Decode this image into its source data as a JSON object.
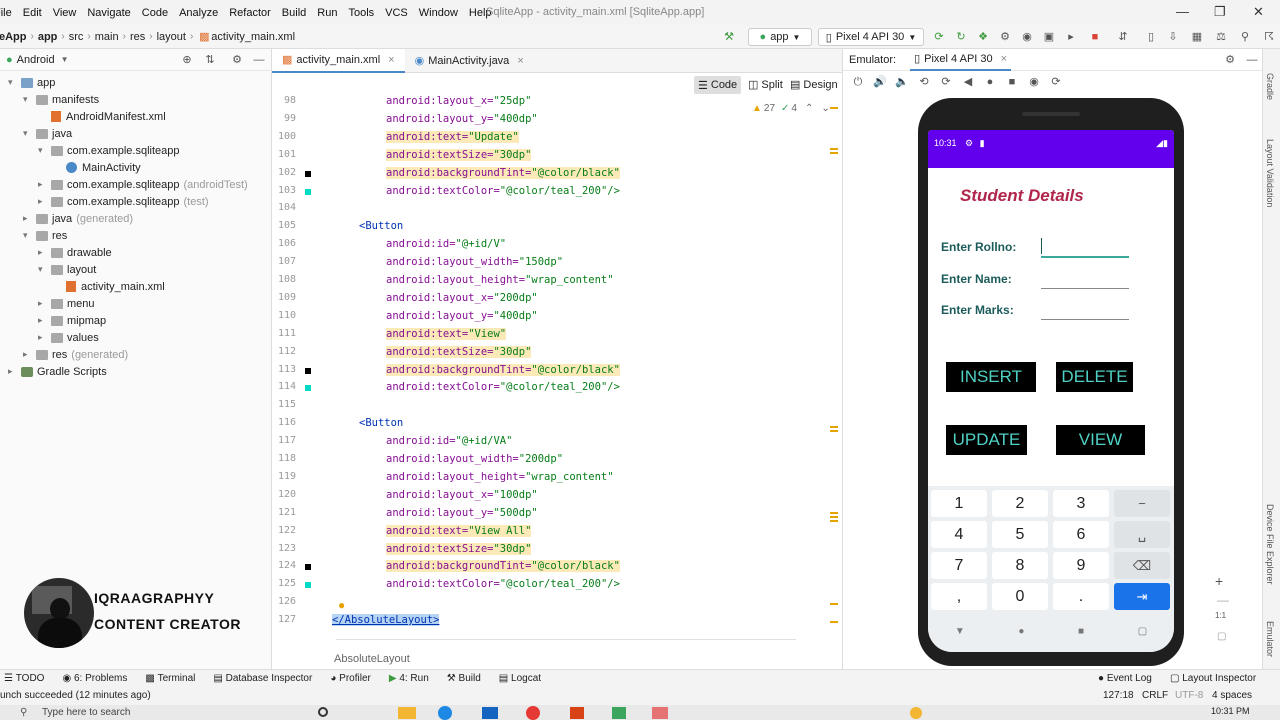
{
  "menu": {
    "items": [
      "File",
      "Edit",
      "View",
      "Navigate",
      "Code",
      "Analyze",
      "Refactor",
      "Build",
      "Run",
      "Tools",
      "VCS",
      "Window",
      "Help"
    ],
    "window_title": "SqliteApp - activity_main.xml [SqliteApp.app]"
  },
  "navbar": {
    "crumbs": [
      "eApp",
      "app",
      "src",
      "main",
      "res",
      "layout",
      "activity_main.xml"
    ],
    "run_config": "app",
    "device": "Pixel 4 API 30"
  },
  "project": {
    "view_label": "Android",
    "items": [
      {
        "label": "app",
        "depth": 0,
        "type": "folder",
        "open": true
      },
      {
        "label": "manifests",
        "depth": 1,
        "type": "folder",
        "open": true
      },
      {
        "label": "AndroidManifest.xml",
        "depth": 2,
        "type": "file"
      },
      {
        "label": "java",
        "depth": 1,
        "type": "folder",
        "open": true
      },
      {
        "label": "com.example.sqliteapp",
        "depth": 2,
        "type": "folder",
        "open": true
      },
      {
        "label": "MainActivity",
        "depth": 3,
        "type": "class"
      },
      {
        "label": "com.example.sqliteapp",
        "suffix": "(androidTest)",
        "depth": 2,
        "type": "folder"
      },
      {
        "label": "com.example.sqliteapp",
        "suffix": "(test)",
        "depth": 2,
        "type": "folder"
      },
      {
        "label": "java",
        "suffix": "(generated)",
        "depth": 1,
        "type": "folder"
      },
      {
        "label": "res",
        "depth": 1,
        "type": "folder",
        "open": true
      },
      {
        "label": "drawable",
        "depth": 2,
        "type": "folder"
      },
      {
        "label": "layout",
        "depth": 2,
        "type": "folder",
        "open": true
      },
      {
        "label": "activity_main.xml",
        "depth": 3,
        "type": "file"
      },
      {
        "label": "menu",
        "depth": 2,
        "type": "folder"
      },
      {
        "label": "mipmap",
        "depth": 2,
        "type": "folder"
      },
      {
        "label": "values",
        "depth": 2,
        "type": "folder"
      },
      {
        "label": "res",
        "suffix": "(generated)",
        "depth": 1,
        "type": "folder"
      },
      {
        "label": "Gradle Scripts",
        "depth": 0,
        "type": "gradle"
      }
    ]
  },
  "editor": {
    "tabs": [
      "activity_main.xml",
      "MainActivity.java"
    ],
    "modes": [
      "Code",
      "Split",
      "Design"
    ],
    "inspections": {
      "warnings": "27",
      "weak": "4"
    },
    "breadcrumb": "AbsoluteLayout",
    "lines": [
      {
        "n": "98",
        "indent": 2,
        "attr": "android:layout_x=",
        "val": "\"25dp\""
      },
      {
        "n": "99",
        "indent": 2,
        "attr": "android:layout_y=",
        "val": "\"400dp\""
      },
      {
        "n": "100",
        "indent": 2,
        "attr": "android:text=",
        "val": "\"Update\"",
        "hl": true
      },
      {
        "n": "101",
        "indent": 2,
        "attr": "android:textSize=",
        "val": "\"30dp\"",
        "hl": true
      },
      {
        "n": "102",
        "indent": 2,
        "attr": "android:backgroundTint=",
        "val": "\"@color/black\"",
        "hl": true,
        "mark": "#000000"
      },
      {
        "n": "103",
        "indent": 2,
        "attr": "android:textColor=",
        "val": "\"@color/teal_200\"/>",
        "mark": "#03dac5"
      },
      {
        "n": "104",
        "indent": 0,
        "attr": "",
        "val": ""
      },
      {
        "n": "105",
        "indent": 1,
        "tag": "<Button"
      },
      {
        "n": "106",
        "indent": 2,
        "attr": "android:id=",
        "val": "\"@+id/V\""
      },
      {
        "n": "107",
        "indent": 2,
        "attr": "android:layout_width=",
        "val": "\"150dp\""
      },
      {
        "n": "108",
        "indent": 2,
        "attr": "android:layout_height=",
        "val": "\"wrap_content\""
      },
      {
        "n": "109",
        "indent": 2,
        "attr": "android:layout_x=",
        "val": "\"200dp\""
      },
      {
        "n": "110",
        "indent": 2,
        "attr": "android:layout_y=",
        "val": "\"400dp\""
      },
      {
        "n": "111",
        "indent": 2,
        "attr": "android:text=",
        "val": "\"View\"",
        "hl": true
      },
      {
        "n": "112",
        "indent": 2,
        "attr": "android:textSize=",
        "val": "\"30dp\"",
        "hl": true
      },
      {
        "n": "113",
        "indent": 2,
        "attr": "android:backgroundTint=",
        "val": "\"@color/black\"",
        "hl": true,
        "mark": "#000000"
      },
      {
        "n": "114",
        "indent": 2,
        "attr": "android:textColor=",
        "val": "\"@color/teal_200\"/>",
        "mark": "#03dac5"
      },
      {
        "n": "115",
        "indent": 0,
        "attr": "",
        "val": ""
      },
      {
        "n": "116",
        "indent": 1,
        "tag": "<Button"
      },
      {
        "n": "117",
        "indent": 2,
        "attr": "android:id=",
        "val": "\"@+id/VA\""
      },
      {
        "n": "118",
        "indent": 2,
        "attr": "android:layout_width=",
        "val": "\"200dp\""
      },
      {
        "n": "119",
        "indent": 2,
        "attr": "android:layout_height=",
        "val": "\"wrap_content\""
      },
      {
        "n": "120",
        "indent": 2,
        "attr": "android:layout_x=",
        "val": "\"100dp\""
      },
      {
        "n": "121",
        "indent": 2,
        "attr": "android:layout_y=",
        "val": "\"500dp\""
      },
      {
        "n": "122",
        "indent": 2,
        "attr": "android:text=",
        "val": "\"View All\"",
        "hl": true
      },
      {
        "n": "123",
        "indent": 2,
        "attr": "android:textSize=",
        "val": "\"30dp\"",
        "hl": true
      },
      {
        "n": "124",
        "indent": 2,
        "attr": "android:backgroundTint=",
        "val": "\"@color/black\"",
        "hl": true,
        "mark": "#000000"
      },
      {
        "n": "125",
        "indent": 2,
        "attr": "android:textColor=",
        "val": "\"@color/teal_200\"/>",
        "mark": "#03dac5"
      },
      {
        "n": "126",
        "indent": 0,
        "attr": "",
        "val": ""
      },
      {
        "n": "127",
        "indent": 0,
        "tag": "</AbsoluteLayout>",
        "selected": true
      }
    ]
  },
  "emulator": {
    "label": "Emulator:",
    "device_tab": "Pixel 4 API 30",
    "phone": {
      "time": "10:31",
      "title": "Student Details",
      "labels": [
        "Enter Rollno:",
        "Enter Name:",
        "Enter Marks:"
      ],
      "buttons": [
        "INSERT",
        "DELETE",
        "UPDATE",
        "VIEW"
      ],
      "keys": [
        "1",
        "2",
        "3",
        "−",
        "4",
        "5",
        "6",
        "␣",
        "7",
        "8",
        "9",
        "⌫",
        ",",
        "0",
        ".",
        "⇥"
      ]
    },
    "zoom_ratio": "1:1"
  },
  "right_strip": [
    "Gradle",
    "Layout Validation",
    "Device File Explorer",
    "Emulator"
  ],
  "toolwindows": [
    "TODO",
    "6: Problems",
    "Terminal",
    "Database Inspector",
    "Profiler",
    "4: Run",
    "Build",
    "Logcat"
  ],
  "toolwindows_right": [
    "Event Log",
    "Layout Inspector"
  ],
  "status": {
    "message": "unch succeeded (12 minutes ago)",
    "position": "127:18",
    "line_sep": "CRLF",
    "encoding": "UTF-8",
    "indent": "4 spaces"
  },
  "taskbar": {
    "search_placeholder": "Type here to search",
    "clock": "10:31 PM"
  },
  "creator": {
    "name": "IQRAAGRAPHYY",
    "role": "CONTENT CREATOR"
  },
  "colors": {
    "accent": "#4a88c7",
    "status_bar": "#6200ee",
    "title": "#b0264a",
    "button_text": "#4fd1c5",
    "enter_key": "#1a73e8"
  }
}
